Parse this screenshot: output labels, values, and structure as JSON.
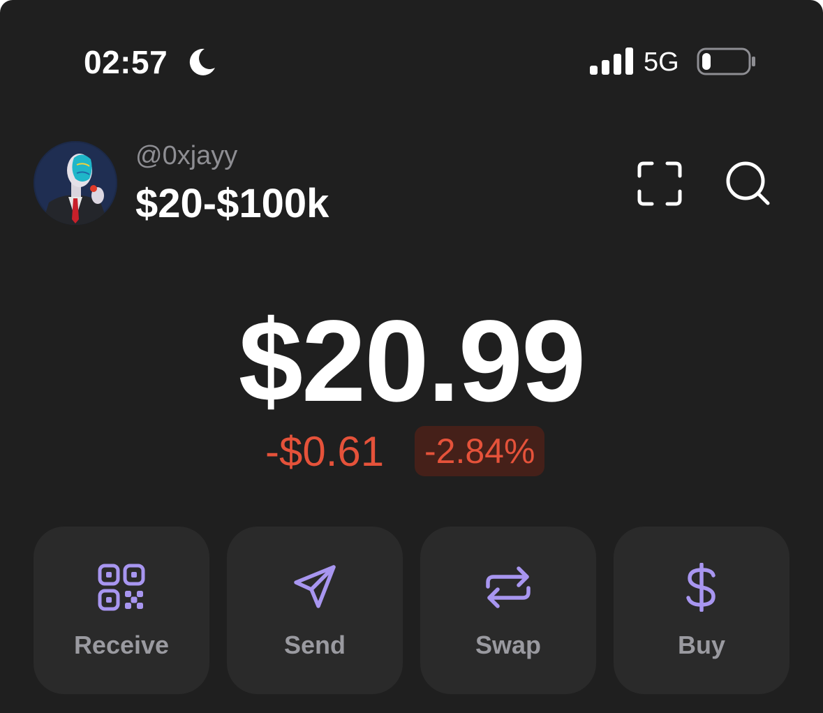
{
  "status_bar": {
    "time": "02:57",
    "network": "5G",
    "focus_icon": "moon-icon",
    "battery_level": 0.2
  },
  "header": {
    "handle": "@0xjayy",
    "wallet_name": "$20-$100k",
    "scan_icon": "scan-icon",
    "search_icon": "search-icon"
  },
  "balance": {
    "amount": "$20.99",
    "change_amount": "-$0.61",
    "change_percent": "-2.84%"
  },
  "actions": [
    {
      "label": "Receive",
      "icon": "qr-code-icon"
    },
    {
      "label": "Send",
      "icon": "send-icon"
    },
    {
      "label": "Swap",
      "icon": "swap-icon"
    },
    {
      "label": "Buy",
      "icon": "dollar-icon"
    }
  ],
  "colors": {
    "background": "#1f1f1f",
    "card": "#2a2a2a",
    "accent": "#a896f0",
    "negative": "#e5523a",
    "negative_bg": "#452019",
    "muted": "#8e8e93"
  }
}
